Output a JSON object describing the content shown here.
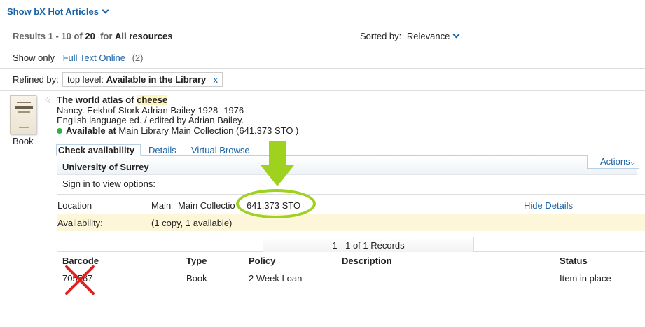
{
  "top": {
    "show_bx_label": "Show bX Hot Articles"
  },
  "results": {
    "prefix": "Results",
    "range_start": "1",
    "range_sep": "- 10 of",
    "total": "20",
    "for_word": "for",
    "scope": "All resources",
    "sorted_label": "Sorted by:",
    "sorted_value": "Relevance"
  },
  "filters": {
    "show_only_label": "Show only",
    "full_text_link": "Full Text Online",
    "full_text_count": "(2)",
    "refined_label": "Refined by:",
    "chip_prefix": "top level:",
    "chip_value": "Available in the Library",
    "chip_remove": "x"
  },
  "record": {
    "type_label": "Book",
    "title_plain": "The world atlas of",
    "title_highlight": "cheese",
    "authors": "Nancy. Eekhof-Stork Adrian Bailey 1928- 1976",
    "edition": "English language ed. / edited by Adrian Bailey.",
    "availability_label": "Available at",
    "availability_detail": "Main Library Main Collection (641.373 STO )"
  },
  "tabs": [
    {
      "label": "Check availability"
    },
    {
      "label": "Details"
    },
    {
      "label": "Virtual Browse"
    }
  ],
  "holdings": {
    "institution": "University of Surrey",
    "actions_label": "Actions",
    "sign_in_text": "Sign in to view options:",
    "location_label": "Location",
    "location_library": "Main",
    "location_collection": "Main Collectio",
    "call_number": "641.373 STO",
    "hide_details": "Hide Details",
    "availability_label": "Availability:",
    "availability_value": "(1 copy, 1 available)",
    "records_label": "1 - 1 of 1 Records",
    "columns": [
      "Barcode",
      "Type",
      "Policy",
      "Description",
      "Status"
    ],
    "rows": [
      {
        "barcode": "705567",
        "type": "Book",
        "policy": "2 Week Loan",
        "description": "",
        "status": "Item in place"
      }
    ]
  },
  "colors": {
    "link": "#1a63a6",
    "annotation_green": "#9ed21e",
    "annotation_red": "#e0201f",
    "available_dot": "#2db24a",
    "availability_row_bg": "#fdf6d8"
  }
}
